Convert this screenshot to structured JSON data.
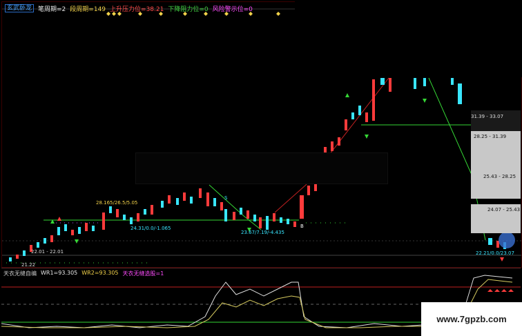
{
  "indicator_bar": {
    "name": "玄武卧龙",
    "bi_zhouqi": "笔周期=2",
    "duan_zhouqi": "段周期=149",
    "shangsheng": "上升压力位=38.21",
    "xiajiang": "下降阻力位=0",
    "fengxian": "风险警示位=0"
  },
  "price_levels": [
    "31.39 - 33.07",
    "28.25 - 31.39",
    "25.43 - 28.25",
    "24.07 - 25.43"
  ],
  "chart_labels": {
    "l1": "28.165/26.5/5.05",
    "l2": "24.31/0.0/-1.065",
    "l3": "23.67/7.19/-4.435",
    "l4": "22.01 - 22.01",
    "l5": "21.22",
    "l6": "22.21/0.0/23.07"
  },
  "sub_bar": {
    "name": "天衣无缝自编",
    "wr1": "WR1=93.305",
    "wr2": "WR2=93.305",
    "signal": "天衣无缝选股=1"
  },
  "watermark": "www.7gpzb.com",
  "colors": {
    "up": "#ff3b3b",
    "down": "#39e6ff",
    "green": "#35d635",
    "yellow": "#f2d24a"
  }
}
